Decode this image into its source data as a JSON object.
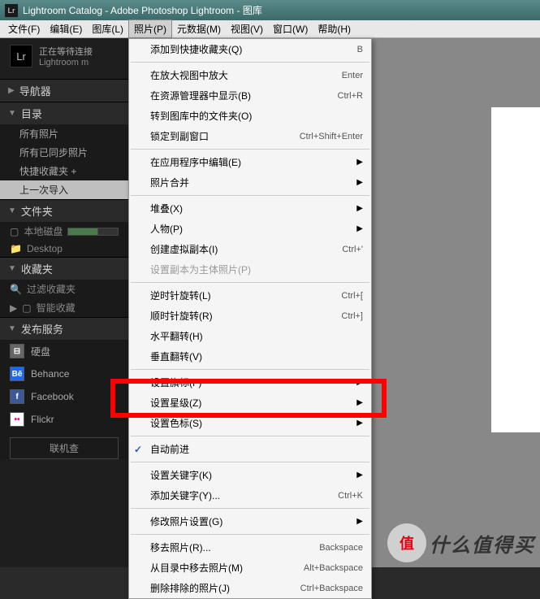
{
  "title": "Lightroom Catalog - Adobe Photoshop Lightroom - 图库",
  "logo": "Lr",
  "waiting_text": "正在等待连接",
  "product_line": "Lightroom m",
  "menubar": [
    "文件(F)",
    "编辑(E)",
    "图库(L)",
    "照片(P)",
    "元数据(M)",
    "视图(V)",
    "窗口(W)",
    "帮助(H)"
  ],
  "sidebar": {
    "navigator": "导航器",
    "catalog": {
      "title": "目录",
      "items": [
        "所有照片",
        "所有已同步照片",
        "快捷收藏夹  +",
        "上一次导入"
      ]
    },
    "folders": {
      "title": "文件夹",
      "drive": "本地磁盘",
      "desktop": "Desktop"
    },
    "collections": {
      "title": "收藏夹",
      "filter": "过滤收藏夹",
      "smart": "智能收藏"
    },
    "publish": {
      "title": "发布服务",
      "services": [
        {
          "icon": "hdd",
          "label": "硬盘"
        },
        {
          "icon": "be",
          "label": "Behance"
        },
        {
          "icon": "fb",
          "label": "Facebook"
        },
        {
          "icon": "fl",
          "label": "Flickr"
        }
      ],
      "connect": "联机查"
    }
  },
  "dropdown": [
    {
      "label": "添加到快捷收藏夹(Q)",
      "shortcut": "B"
    },
    {
      "sep": true
    },
    {
      "label": "在放大视图中放大",
      "shortcut": "Enter"
    },
    {
      "label": "在资源管理器中显示(B)",
      "shortcut": "Ctrl+R"
    },
    {
      "label": "转到图库中的文件夹(O)"
    },
    {
      "label": "锁定到副窗口",
      "shortcut": "Ctrl+Shift+Enter"
    },
    {
      "sep": true
    },
    {
      "label": "在应用程序中编辑(E)",
      "submenu": true
    },
    {
      "label": "照片合并",
      "submenu": true
    },
    {
      "sep": true
    },
    {
      "label": "堆叠(X)",
      "submenu": true
    },
    {
      "label": "人物(P)",
      "submenu": true
    },
    {
      "label": "创建虚拟副本(I)",
      "shortcut": "Ctrl+'"
    },
    {
      "label": "设置副本为主体照片(P)",
      "disabled": true
    },
    {
      "sep": true
    },
    {
      "label": "逆时针旋转(L)",
      "shortcut": "Ctrl+["
    },
    {
      "label": "顺时针旋转(R)",
      "shortcut": "Ctrl+]"
    },
    {
      "label": "水平翻转(H)"
    },
    {
      "label": "垂直翻转(V)"
    },
    {
      "sep": true
    },
    {
      "label": "设置旗标(F)",
      "submenu": true
    },
    {
      "label": "设置星级(Z)",
      "submenu": true
    },
    {
      "label": "设置色标(S)",
      "submenu": true
    },
    {
      "sep": true
    },
    {
      "label": "自动前进",
      "checked": true
    },
    {
      "sep": true
    },
    {
      "label": "设置关键字(K)",
      "submenu": true
    },
    {
      "label": "添加关键字(Y)...",
      "shortcut": "Ctrl+K"
    },
    {
      "sep": true
    },
    {
      "label": "修改照片设置(G)",
      "submenu": true
    },
    {
      "sep": true
    },
    {
      "label": "移去照片(R)...",
      "shortcut": "Backspace"
    },
    {
      "label": "从目录中移去照片(M)",
      "shortcut": "Alt+Backspace"
    },
    {
      "label": "删除排除的照片(J)",
      "shortcut": "Ctrl+Backspace"
    }
  ],
  "watermark": {
    "badge": "值",
    "text": "什么值得买"
  }
}
